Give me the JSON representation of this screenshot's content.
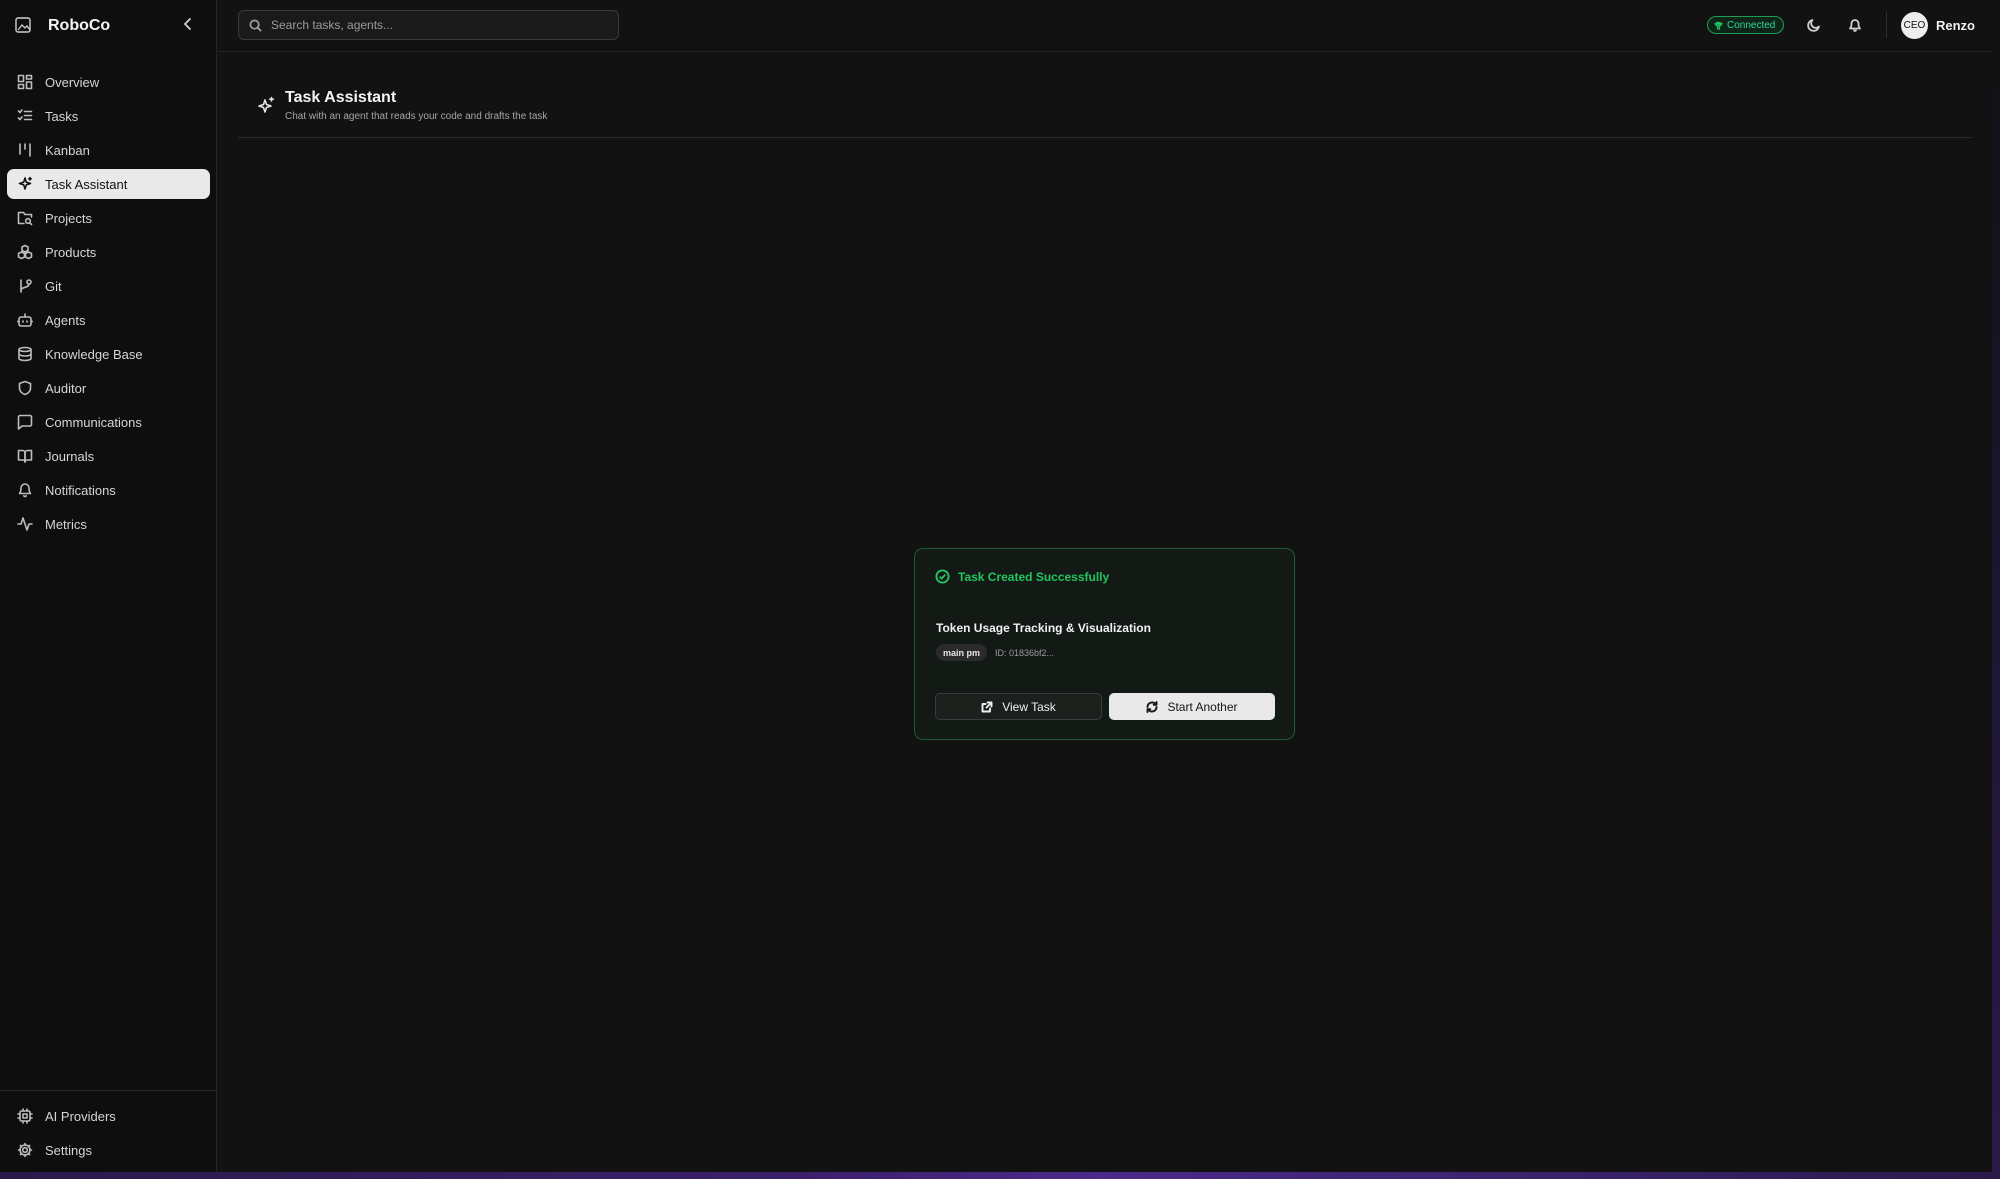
{
  "app": {
    "name": "RoboCo"
  },
  "sidebar": {
    "items": [
      {
        "label": "Overview",
        "icon": "dashboard-icon"
      },
      {
        "label": "Tasks",
        "icon": "list-checks-icon"
      },
      {
        "label": "Kanban",
        "icon": "kanban-icon"
      },
      {
        "label": "Task Assistant",
        "icon": "sparkles-icon",
        "active": true
      },
      {
        "label": "Projects",
        "icon": "folder-search-icon"
      },
      {
        "label": "Products",
        "icon": "boxes-icon"
      },
      {
        "label": "Git",
        "icon": "git-branch-icon"
      },
      {
        "label": "Agents",
        "icon": "bot-icon"
      },
      {
        "label": "Knowledge Base",
        "icon": "database-icon"
      },
      {
        "label": "Auditor",
        "icon": "shield-icon"
      },
      {
        "label": "Communications",
        "icon": "message-square-icon"
      },
      {
        "label": "Journals",
        "icon": "book-open-icon"
      },
      {
        "label": "Notifications",
        "icon": "bell-icon"
      },
      {
        "label": "Metrics",
        "icon": "activity-icon"
      }
    ],
    "footer": [
      {
        "label": "AI Providers",
        "icon": "cpu-icon"
      },
      {
        "label": "Settings",
        "icon": "gear-icon"
      }
    ]
  },
  "topbar": {
    "search_placeholder": "Search tasks, agents...",
    "status": "Connected",
    "user": {
      "avatar_text": "CEO",
      "name": "Renzo"
    }
  },
  "page": {
    "title": "Task Assistant",
    "subtitle": "Chat with an agent that reads your code and drafts the task"
  },
  "result": {
    "heading": "Task Created Successfully",
    "task_title": "Token Usage Tracking & Visualization",
    "badge": "main pm",
    "task_id": "ID: 01836bf2...",
    "view_label": "View Task",
    "another_label": "Start Another"
  },
  "colors": {
    "success": "#22c55e",
    "background": "#121212",
    "active_nav": "#e9e9e9"
  }
}
